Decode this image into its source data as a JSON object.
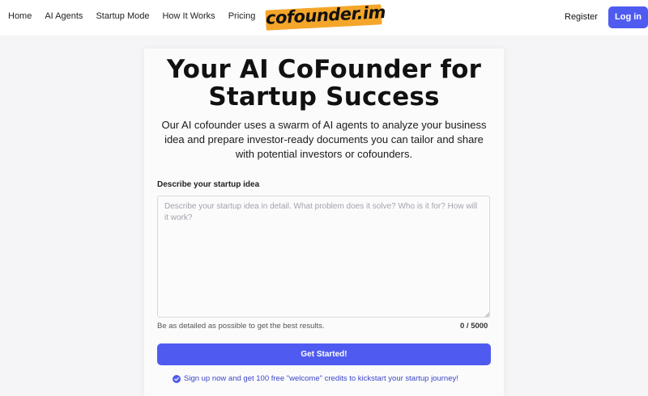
{
  "nav": {
    "links": [
      "Home",
      "AI Agents",
      "Startup Mode",
      "How It Works",
      "Pricing"
    ],
    "logo_text": "cofounder.im",
    "register_label": "Register",
    "login_label": "Log in"
  },
  "hero": {
    "title_line1": "Your AI CoFounder for",
    "title_line2": "Startup Success",
    "subtitle": "Our AI cofounder uses a swarm of AI agents to analyze your business idea and prepare investor-ready documents you can tailor and share with potential investors or cofounders."
  },
  "form": {
    "label": "Describe your startup idea",
    "placeholder": "Describe your startup idea in detail. What problem does it solve? Who is it for? How will it work?",
    "value": "",
    "helper": "Be as detailed as possible to get the best results.",
    "char_count": "0 / 5000",
    "submit_label": "Get Started!",
    "promo": "Sign up now and get 100 free \"welcome\" credits to kickstart your startup journey!"
  },
  "colors": {
    "accent": "#4f5bf0",
    "logo_bg": "#f4a62a",
    "promo_text": "#3c46c8"
  },
  "icons": {
    "promo": "check-circle-icon",
    "textarea_resize": "resize-handle-icon"
  }
}
